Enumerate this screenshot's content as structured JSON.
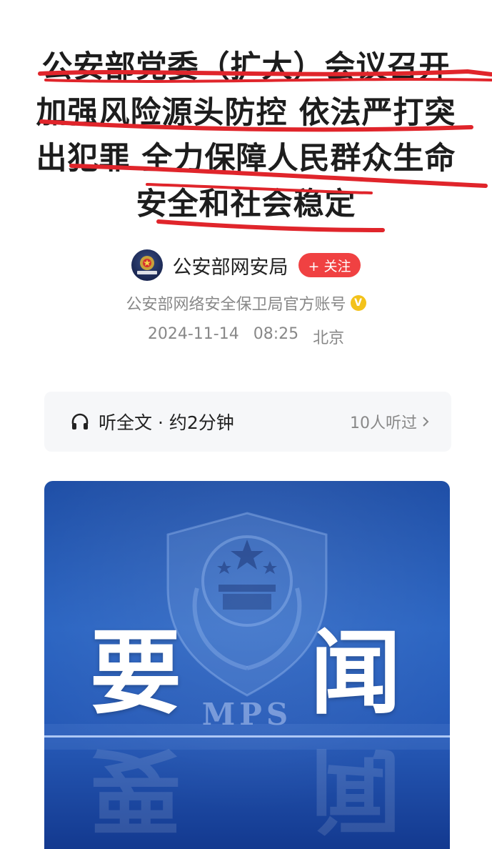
{
  "article": {
    "title_lines": [
      "公安部党委（扩大）会议召开",
      "加强风险源头防控 依法严打突",
      "出犯罪 全力保障人民群众生命",
      "安全和社会稳定"
    ]
  },
  "author": {
    "name": "公安部网安局",
    "follow_label": "+ 关注",
    "description": "公安部网络安全保卫局官方账号",
    "verified_icon": "verified-badge-icon",
    "date": "2024-11-14",
    "time": "08:25",
    "location": "北京",
    "avatar_caption": "公安部网安局"
  },
  "listen": {
    "label": "听全文 · 约2分钟",
    "count_label": "10人听过",
    "icon": "headphones-icon"
  },
  "banner": {
    "char_left": "要",
    "char_right": "闻",
    "emblem_text": "MPS"
  },
  "colors": {
    "annotation_red": "#e0252b",
    "follow_red": "#f04142",
    "banner_blue": "#2a64c2"
  }
}
